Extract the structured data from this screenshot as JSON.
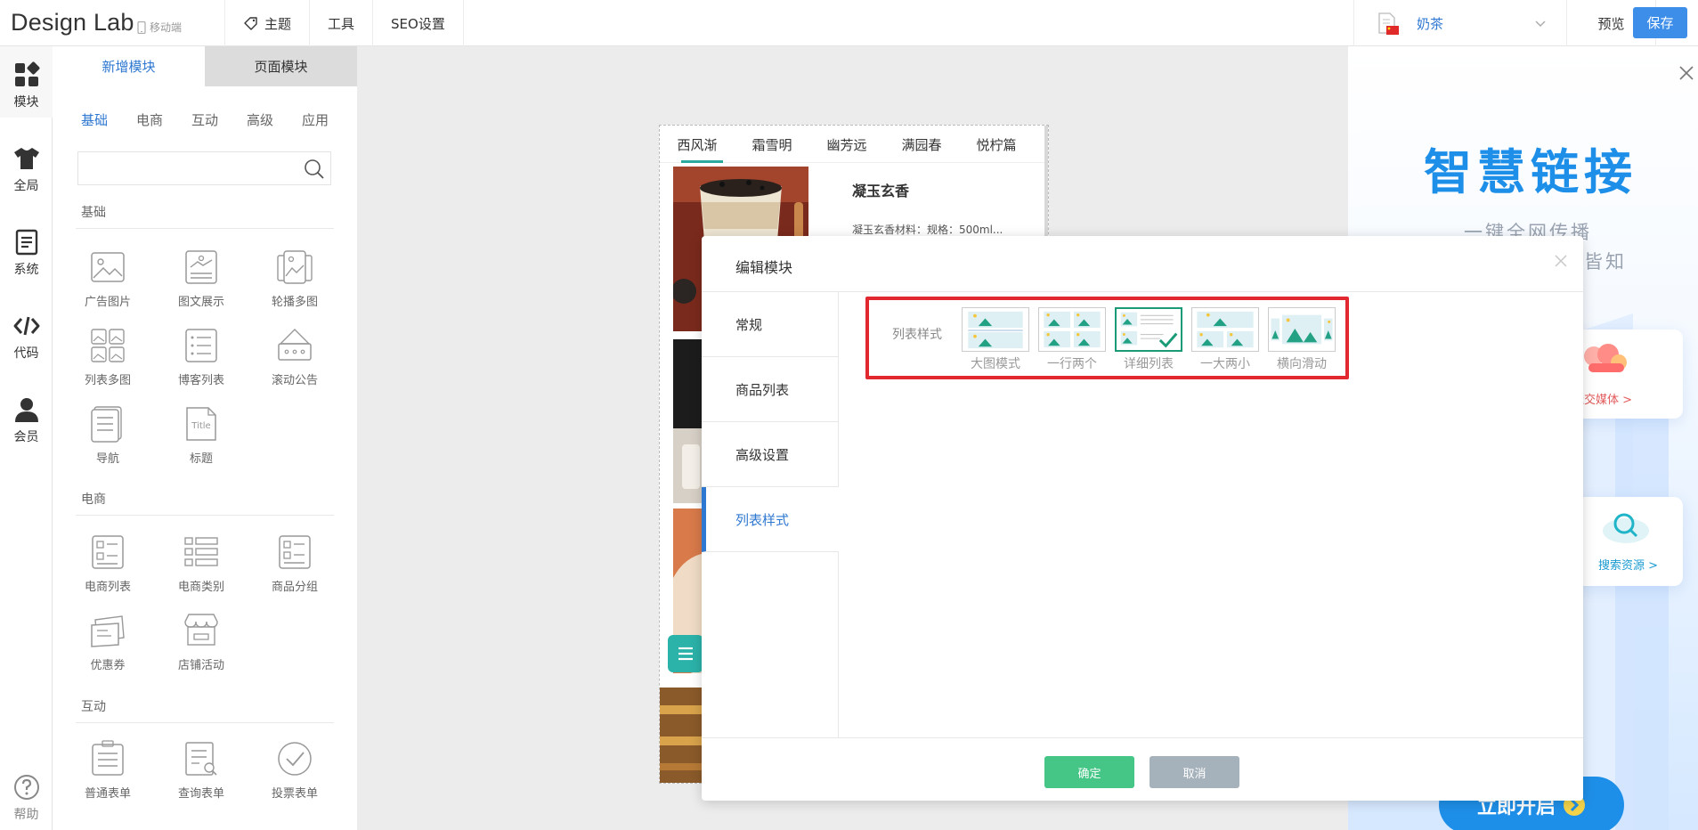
{
  "topbar": {
    "brand": "Design Lab",
    "mobile_label": "移动端",
    "nav": [
      {
        "label": "主题"
      },
      {
        "label": "工具"
      },
      {
        "label": "SEO设置"
      }
    ],
    "site_name": "奶茶",
    "preview_label": "预览",
    "save_label": "保存"
  },
  "rail": {
    "items": [
      {
        "label": "模块",
        "icon": "modules-icon"
      },
      {
        "label": "全局",
        "icon": "shirt-icon"
      },
      {
        "label": "系统",
        "icon": "document-icon"
      },
      {
        "label": "代码",
        "icon": "code-icon"
      },
      {
        "label": "会员",
        "icon": "user-icon"
      }
    ],
    "help_label": "帮助"
  },
  "panel": {
    "tabs": [
      "新增模块",
      "页面模块"
    ],
    "categories": [
      "基础",
      "电商",
      "互动",
      "高级",
      "应用"
    ],
    "search_placeholder": "",
    "sections": {
      "basic": {
        "title": "基础",
        "items": [
          "广告图片",
          "图文展示",
          "轮播多图",
          "列表多图",
          "博客列表",
          "滚动公告",
          "导航",
          "标题"
        ]
      },
      "ecommerce": {
        "title": "电商",
        "items": [
          "电商列表",
          "电商类别",
          "商品分组",
          "优惠券",
          "店铺活动"
        ]
      },
      "interactive": {
        "title": "互动",
        "items": [
          "普通表单",
          "查询表单",
          "投票表单"
        ]
      }
    },
    "title_icon_text": "Title"
  },
  "phone": {
    "tabs": [
      "西风渐",
      "霜雪明",
      "幽芳远",
      "满园春",
      "悦柠篇"
    ],
    "product_title": "凝玉玄香",
    "product_desc": "凝玉玄香材料：规格：500ml..."
  },
  "modal": {
    "title": "编辑模块",
    "side_items": [
      "常规",
      "商品列表",
      "高级设置",
      "列表样式"
    ],
    "style_label": "列表样式",
    "style_options": [
      "大图模式",
      "一行两个",
      "详细列表",
      "一大两小",
      "横向滑动"
    ],
    "selected_style": "详细列表",
    "ok_label": "确定",
    "cancel_label": "取消"
  },
  "promo": {
    "title": "智慧链接",
    "subtitle_1": "一键全网传播",
    "subtitle_2": "皆知",
    "card_social": "社交媒体 >",
    "card_search": "搜索资源 >",
    "cta": "立即开启"
  },
  "colors": {
    "accent": "#2f78d1",
    "save": "#3d8ee8",
    "ok": "#45c686",
    "cancel": "#a6b2bb",
    "highlight": "#e0282e",
    "teal": "#2aa99f"
  }
}
